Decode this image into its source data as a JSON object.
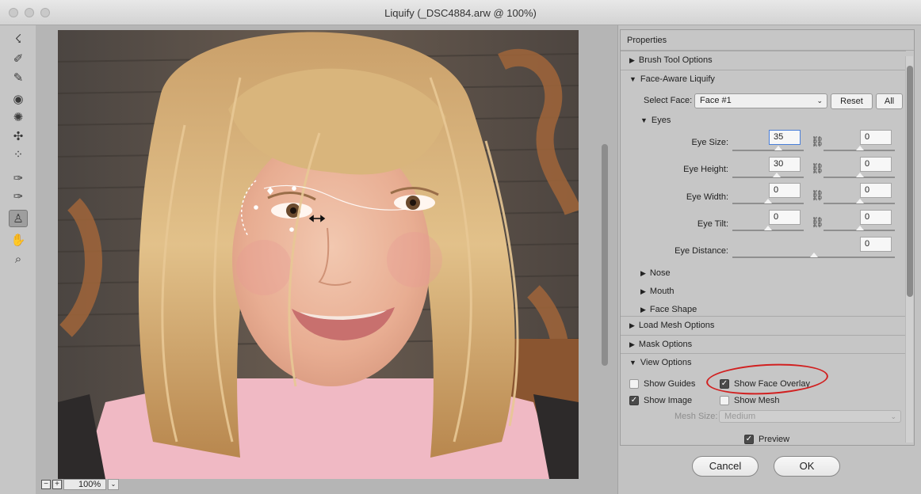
{
  "window": {
    "title": "Liquify (_DSC4884.arw @ 100%)"
  },
  "tools": [
    {
      "name": "forward-warp-icon",
      "glyph": "☇"
    },
    {
      "name": "reconstruct-icon",
      "glyph": "✐"
    },
    {
      "name": "smooth-icon",
      "glyph": "✎"
    },
    {
      "name": "twirl-icon",
      "glyph": "◉"
    },
    {
      "name": "pucker-icon",
      "glyph": "✺"
    },
    {
      "name": "bloat-icon",
      "glyph": "✣"
    },
    {
      "name": "push-left-icon",
      "glyph": "⁘"
    },
    {
      "name": "freeze-mask-icon",
      "glyph": "✑"
    },
    {
      "name": "thaw-mask-icon",
      "glyph": "✑"
    },
    {
      "name": "face-tool-icon",
      "glyph": "♙"
    },
    {
      "name": "hand-icon",
      "glyph": "✋"
    },
    {
      "name": "zoom-icon",
      "glyph": "⌕"
    }
  ],
  "canvas": {
    "zoom": "100%"
  },
  "properties": {
    "title": "Properties",
    "brush_tool_options": "Brush Tool Options",
    "face_aware": "Face-Aware Liquify",
    "select_face_label": "Select Face:",
    "select_face_value": "Face #1",
    "reset": "Reset",
    "all": "All",
    "eyes": "Eyes",
    "eye_size_label": "Eye Size:",
    "eye_size_left": "35",
    "eye_size_right": "0",
    "eye_height_label": "Eye Height:",
    "eye_height_left": "30",
    "eye_height_right": "0",
    "eye_width_label": "Eye Width:",
    "eye_width_left": "0",
    "eye_width_right": "0",
    "eye_tilt_label": "Eye Tilt:",
    "eye_tilt_left": "0",
    "eye_tilt_right": "0",
    "eye_distance_label": "Eye Distance:",
    "eye_distance_value": "0",
    "nose": "Nose",
    "mouth": "Mouth",
    "face_shape": "Face Shape",
    "load_mesh_options": "Load Mesh Options",
    "mask_options": "Mask Options",
    "view_options": "View Options",
    "show_guides": "Show Guides",
    "show_face_overlay": "Show Face Overlay",
    "show_image": "Show Image",
    "show_mesh": "Show Mesh",
    "mesh_size_label": "Mesh Size:",
    "mesh_size_value": "Medium",
    "show_guides_checked": false,
    "show_face_overlay_checked": true,
    "show_image_checked": true,
    "show_mesh_checked": false
  },
  "footer": {
    "preview": "Preview",
    "preview_checked": true,
    "cancel": "Cancel",
    "ok": "OK"
  }
}
